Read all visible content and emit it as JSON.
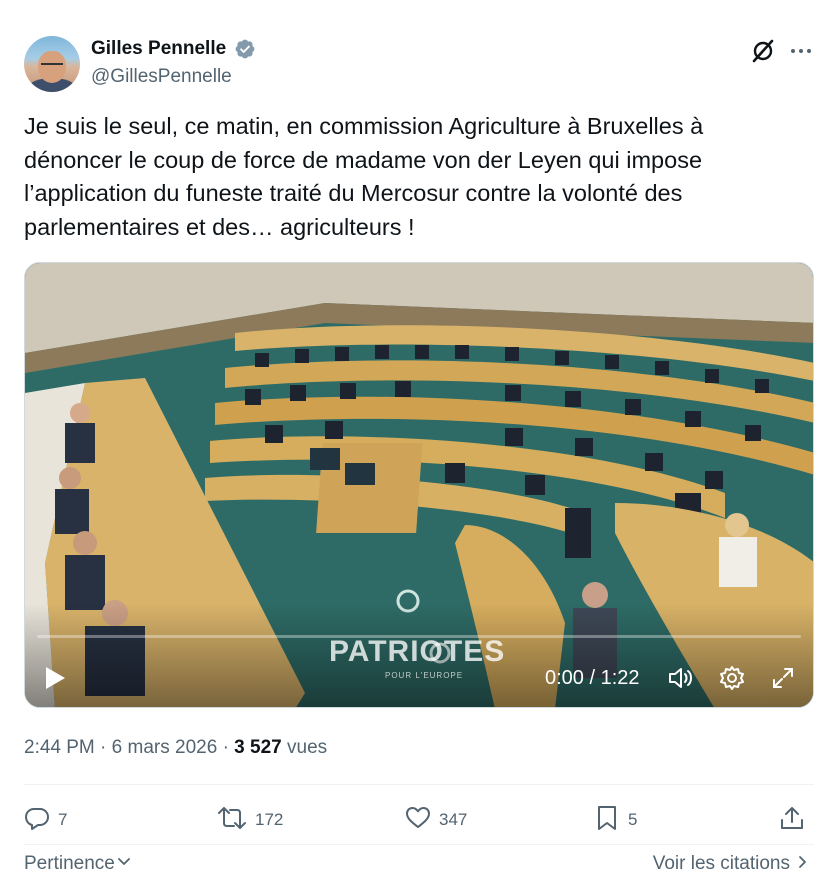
{
  "author": {
    "display_name": "Gilles Pennelle",
    "handle": "@GillesPennelle",
    "verified": true
  },
  "tweet": {
    "text": "Je suis le seul, ce matin, en commission Agriculture à Bruxelles à dénoncer le coup de force de madame von der Leyen qui impose l’application du funeste traité du Mercosur contre la volonté des parlementaires et des… agriculteurs !"
  },
  "video": {
    "watermark": "PATRIOTES",
    "watermark_sub": "POUR L'EUROPE",
    "current_time": "0:00",
    "duration": "1:22",
    "time_display": "0:00 / 1:22",
    "progress_percent": 0
  },
  "meta": {
    "time": "2:44 PM",
    "date": "6 mars 2026",
    "separator": "·",
    "views_count": "3 527",
    "views_label": "vues"
  },
  "actions": {
    "replies": "7",
    "reposts": "172",
    "likes": "347",
    "bookmarks": "5"
  },
  "footer": {
    "sort_label": "Pertinence",
    "quotes_label": "Voir les citations"
  },
  "colors": {
    "text_primary": "#0f1419",
    "text_secondary": "#536471",
    "verified_blue": "#1d9bf0",
    "divider": "#eff3f4"
  },
  "icons": {
    "verified": "verified-badge-icon",
    "grok": "grok-icon",
    "more": "more-icon",
    "play": "play-icon",
    "volume": "volume-icon",
    "settings": "gear-icon",
    "fullscreen": "fullscreen-icon",
    "reply": "reply-icon",
    "repost": "repost-icon",
    "like": "heart-icon",
    "bookmark": "bookmark-icon",
    "share": "share-icon",
    "sort_chevron": "chevron-down-icon",
    "quotes_chevron": "chevron-right-icon"
  }
}
